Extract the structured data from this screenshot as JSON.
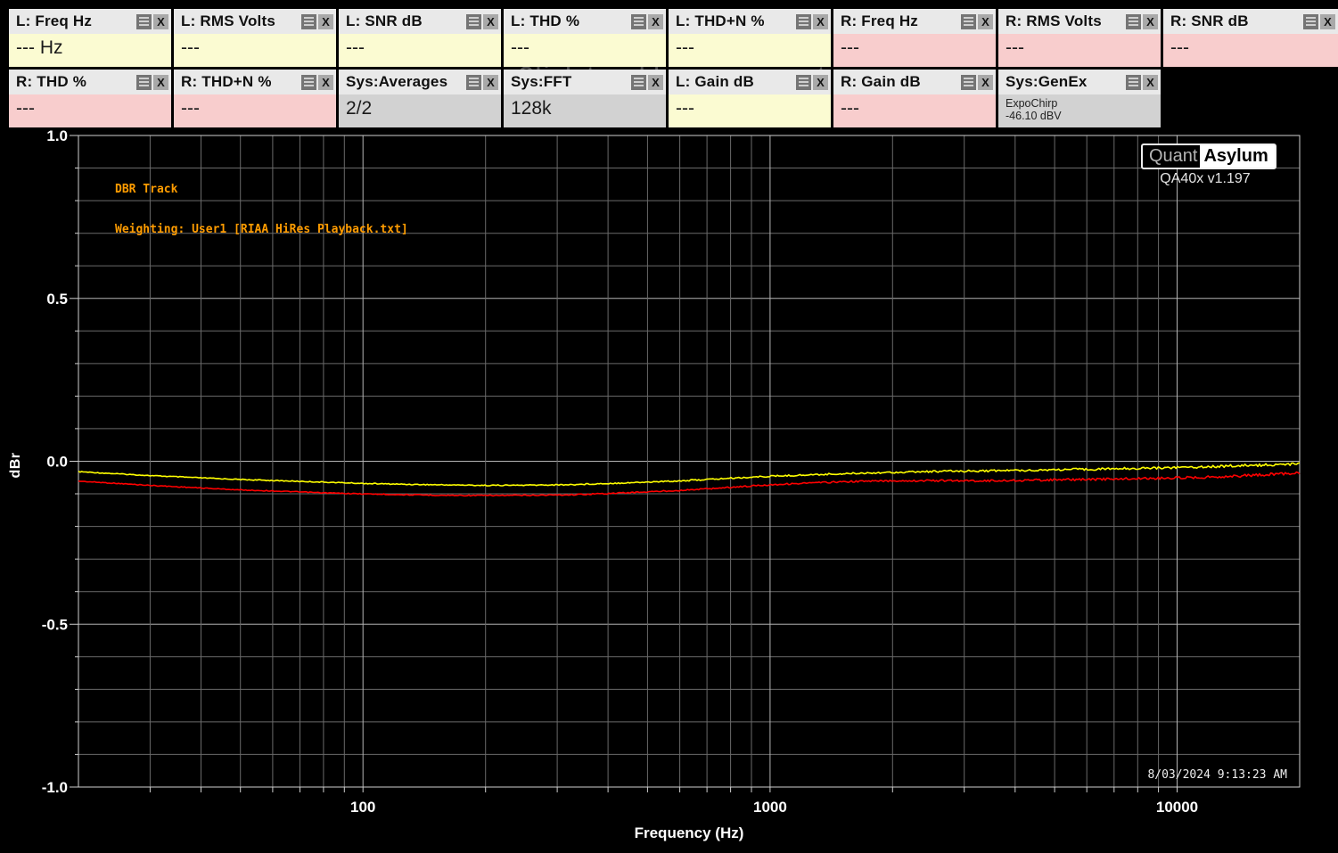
{
  "colors": {
    "left_channel_bg": "#fbfbd2",
    "right_channel_bg": "#f8cdcd",
    "sys_bg": "#d2d2d2",
    "header_bg": "#e9e9e9",
    "series_left": "#ffff00",
    "series_right": "#ff0000",
    "annotation": "#ff9c00",
    "grid_minor": "#6a6a6a",
    "grid_major": "#b4b4b4",
    "axis": "#cfcfcf"
  },
  "brand": {
    "logo_left": "Quant",
    "logo_right": "Asylum",
    "version": "QA40x v1.197"
  },
  "measurement_bar": {
    "hidden_hint": "Click to add measurement",
    "close_icon_glyph": "X",
    "rows": [
      {
        "panels": [
          {
            "title": "L: Freq Hz",
            "value": "--- Hz",
            "channel": "left"
          },
          {
            "title": "L: RMS Volts",
            "value": "---",
            "channel": "left"
          },
          {
            "title": "L: SNR dB",
            "value": "---",
            "channel": "left"
          },
          {
            "title": "L: THD %",
            "value": "---",
            "channel": "left"
          },
          {
            "title": "L: THD+N %",
            "value": "---",
            "channel": "left"
          },
          {
            "title": "R: Freq Hz",
            "value": "---",
            "channel": "right"
          },
          {
            "title": "R: RMS Volts",
            "value": "---",
            "channel": "right"
          },
          {
            "title": "R: SNR dB",
            "value": "---",
            "channel": "right"
          }
        ]
      },
      {
        "panels": [
          {
            "title": "R: THD %",
            "value": "---",
            "channel": "right"
          },
          {
            "title": "R: THD+N %",
            "value": "---",
            "channel": "right"
          },
          {
            "title": "Sys:Averages",
            "value": "2/2",
            "channel": "sys"
          },
          {
            "title": "Sys:FFT",
            "value": "128k",
            "channel": "sys"
          },
          {
            "title": "L: Gain dB",
            "value": "---",
            "channel": "left"
          },
          {
            "title": "R: Gain dB",
            "value": "---",
            "channel": "right"
          },
          {
            "title": "Sys:GenEx",
            "value": "ExpoChirp",
            "value2": "-46.10 dBV",
            "channel": "sys",
            "small": true
          }
        ]
      }
    ]
  },
  "chart_data": {
    "type": "line",
    "x_axis": {
      "label": "Frequency (Hz)",
      "scale": "log",
      "min": 20,
      "max": 20000,
      "ticks": [
        {
          "label": "100",
          "value": 100
        },
        {
          "label": "1000",
          "value": 1000
        },
        {
          "label": "10000",
          "value": 10000
        }
      ]
    },
    "y_axis": {
      "label": "dBr",
      "min": -1.0,
      "max": 1.0,
      "major_step": 0.5,
      "minor_step": 0.1,
      "ticks": [
        {
          "label": "1.0",
          "value": 1.0
        },
        {
          "label": "0.5",
          "value": 0.5
        },
        {
          "label": "0.0",
          "value": 0.0
        },
        {
          "label": "-0.5",
          "value": -0.5
        },
        {
          "label": "-1.0",
          "value": -1.0
        }
      ]
    },
    "annotations": {
      "line1": "DBR Track",
      "line2": "Weighting: User1 [RIAA HiRes Playback.txt]",
      "timestamp": "8/03/2024 9:13:23 AM"
    },
    "series": [
      {
        "name": "Left (yellow)",
        "color": "#ffff00",
        "points": [
          [
            20,
            -0.032
          ],
          [
            30,
            -0.044
          ],
          [
            40,
            -0.051
          ],
          [
            50,
            -0.056
          ],
          [
            63,
            -0.06
          ],
          [
            80,
            -0.064
          ],
          [
            100,
            -0.068
          ],
          [
            130,
            -0.071
          ],
          [
            160,
            -0.0725
          ],
          [
            200,
            -0.074
          ],
          [
            250,
            -0.0735
          ],
          [
            320,
            -0.072
          ],
          [
            400,
            -0.068
          ],
          [
            500,
            -0.064
          ],
          [
            630,
            -0.059
          ],
          [
            800,
            -0.052
          ],
          [
            1000,
            -0.046
          ],
          [
            1300,
            -0.041
          ],
          [
            1600,
            -0.037
          ],
          [
            2000,
            -0.034
          ],
          [
            2600,
            -0.031
          ],
          [
            3300,
            -0.0295
          ],
          [
            4000,
            -0.028
          ],
          [
            5000,
            -0.026
          ],
          [
            6300,
            -0.024
          ],
          [
            8000,
            -0.0215
          ],
          [
            10000,
            -0.019
          ],
          [
            13000,
            -0.015
          ],
          [
            16000,
            -0.012
          ],
          [
            20000,
            -0.008
          ]
        ]
      },
      {
        "name": "Right (red)",
        "color": "#ff0000",
        "points": [
          [
            20,
            -0.061
          ],
          [
            30,
            -0.074
          ],
          [
            40,
            -0.082
          ],
          [
            50,
            -0.088
          ],
          [
            63,
            -0.092
          ],
          [
            80,
            -0.097
          ],
          [
            100,
            -0.1
          ],
          [
            130,
            -0.103
          ],
          [
            160,
            -0.1045
          ],
          [
            200,
            -0.105
          ],
          [
            250,
            -0.1045
          ],
          [
            320,
            -0.103
          ],
          [
            400,
            -0.099
          ],
          [
            500,
            -0.094
          ],
          [
            630,
            -0.088
          ],
          [
            800,
            -0.08
          ],
          [
            1000,
            -0.072
          ],
          [
            1300,
            -0.066
          ],
          [
            1600,
            -0.062
          ],
          [
            2000,
            -0.06
          ],
          [
            2600,
            -0.0595
          ],
          [
            3300,
            -0.06
          ],
          [
            4000,
            -0.059
          ],
          [
            5000,
            -0.057
          ],
          [
            6300,
            -0.0555
          ],
          [
            8000,
            -0.053
          ],
          [
            10000,
            -0.051
          ],
          [
            13000,
            -0.047
          ],
          [
            16000,
            -0.042
          ],
          [
            20000,
            -0.035
          ]
        ]
      }
    ]
  }
}
